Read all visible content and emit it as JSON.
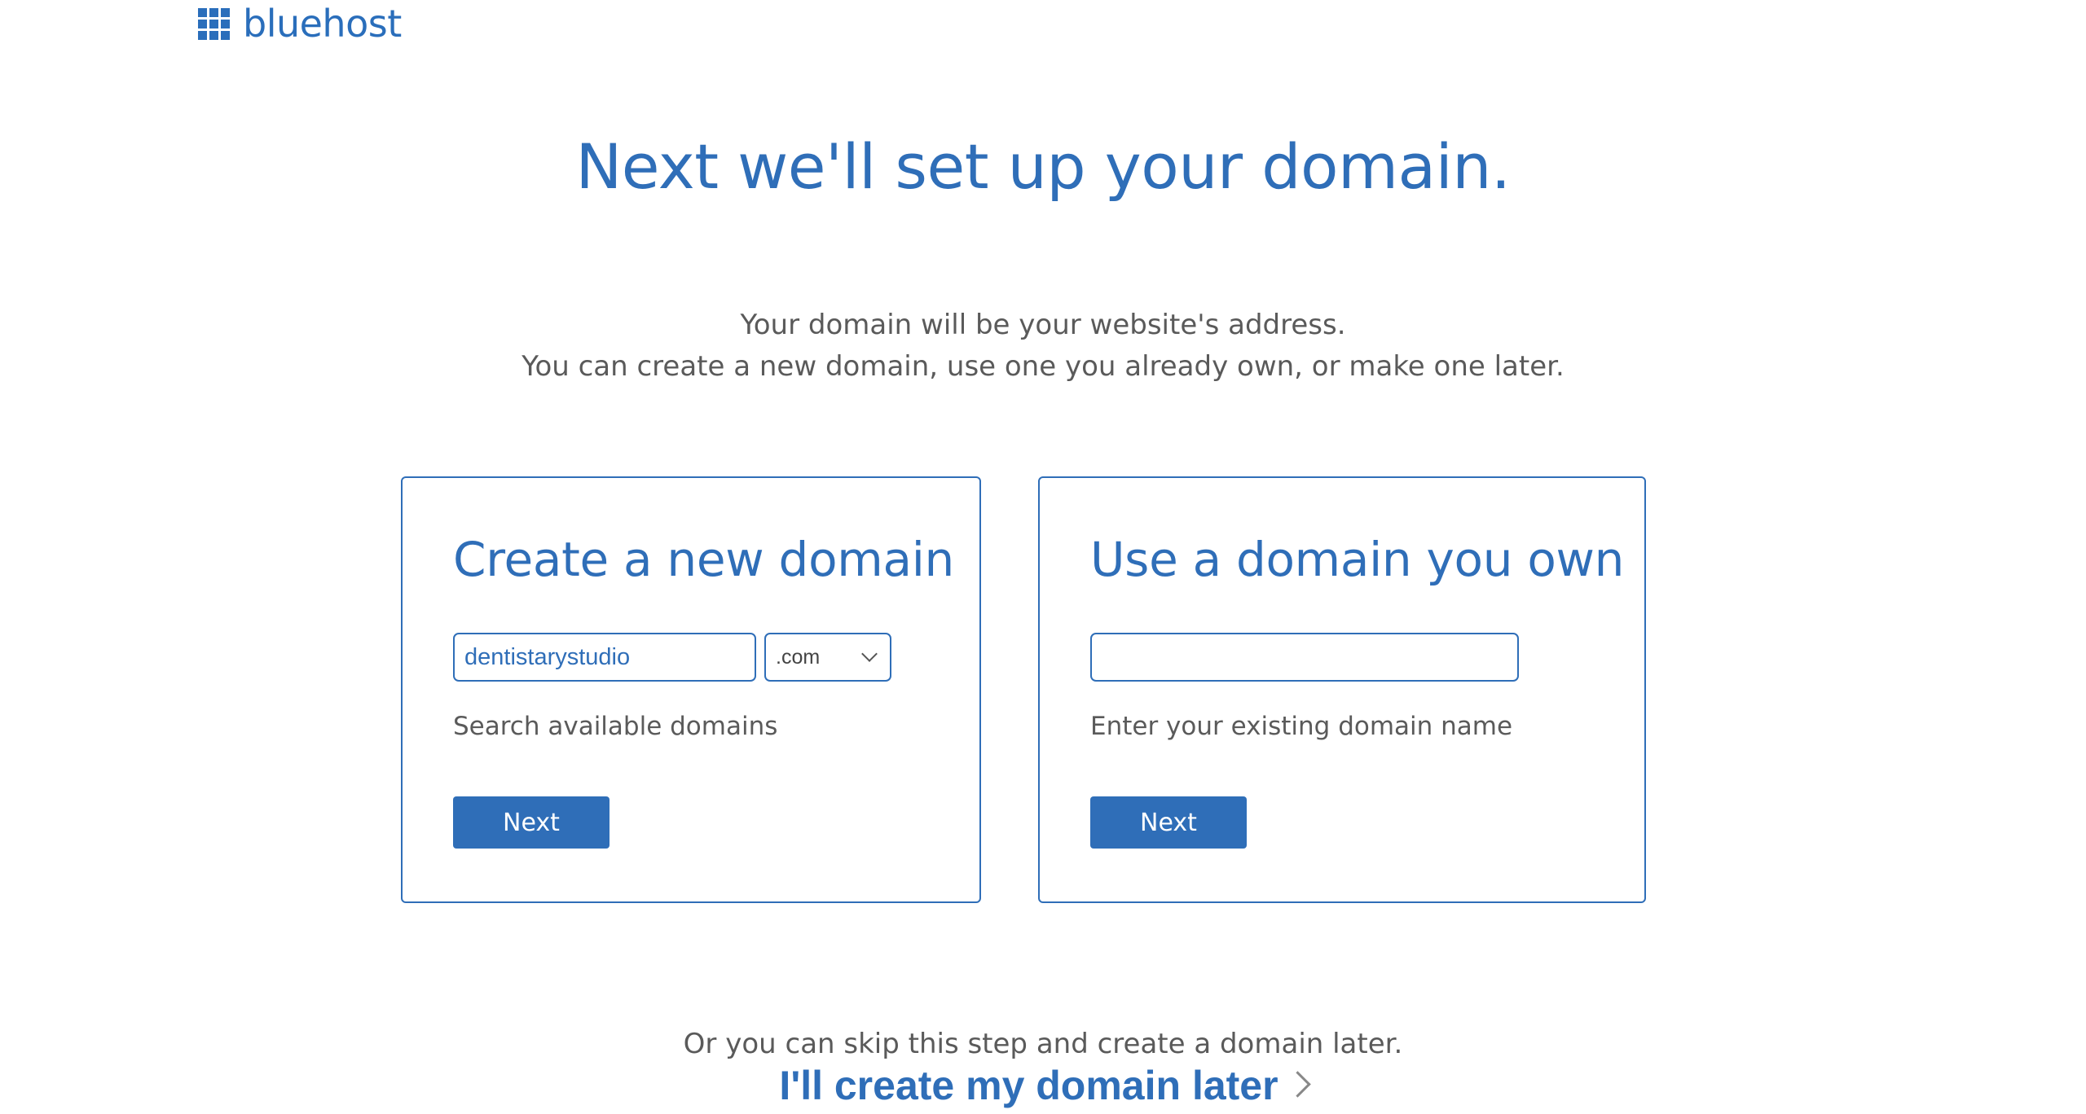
{
  "brand": {
    "logo_text": "bluehost",
    "color": "#2a6ebb"
  },
  "page": {
    "title": "Next we'll set up your domain.",
    "intro_line_1": "Your domain will be your website's address.",
    "intro_line_2": "You can create a new domain, use one you already own, or make one later."
  },
  "new_domain_card": {
    "title": "Create a new domain",
    "domain_input_value": "dentistarystudio",
    "tld_selected": ".com",
    "helper": "Search available domains",
    "next_label": "Next"
  },
  "own_domain_card": {
    "title": "Use a domain you own",
    "domain_input_value": "",
    "helper": "Enter your existing domain name",
    "next_label": "Next"
  },
  "skip": {
    "text": "Or you can skip this step and create a domain later.",
    "link_label": "I'll create my domain later"
  },
  "colors": {
    "accent": "#2f6eb8",
    "text_muted": "#5a5a5a"
  },
  "icons": {
    "logo": "grid-logo-icon",
    "select_arrow": "chevron-down-icon",
    "link_arrow": "chevron-right-icon"
  }
}
